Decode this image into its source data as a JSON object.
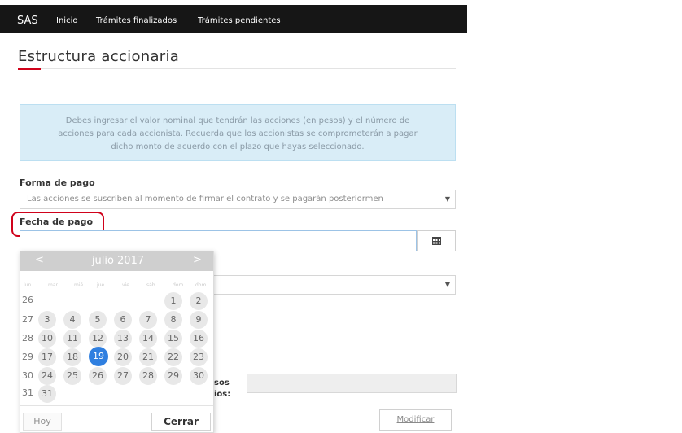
{
  "navbar": {
    "brand": "SAS",
    "items": [
      "Inicio",
      "Trámites finalizados",
      "Trámites pendientes"
    ]
  },
  "page": {
    "title": "Estructura accionaria"
  },
  "alert": {
    "lines": [
      "Debes ingresar el valor nominal que tendrán las acciones (en pesos) y el número de",
      "acciones para cada accionista. Recuerda que los accionistas se comprometerán a pagar",
      "dicho monto de acuerdo con el plazo que hayas seleccionado."
    ]
  },
  "forma_pago": {
    "label": "Forma de pago",
    "selected": "Las acciones se suscriben al momento de firmar el contrato y se pagarán posteriormen"
  },
  "fecha_pago": {
    "label": "Fecha de pago",
    "value": ""
  },
  "second_select": {
    "selected": ""
  },
  "calendar": {
    "month_label": "julio 2017",
    "prev": "<",
    "next": ">",
    "weekday_headers": [
      "lun",
      "mar",
      "mié",
      "jue",
      "vie",
      "sáb",
      "dom"
    ],
    "week_numbers": [
      "26",
      "27",
      "28",
      "29",
      "30",
      "31"
    ],
    "rows": [
      [
        "",
        "",
        "",
        "",
        "",
        "1",
        "2"
      ],
      [
        "3",
        "4",
        "5",
        "6",
        "7",
        "8",
        "9"
      ],
      [
        "10",
        "11",
        "12",
        "13",
        "14",
        "15",
        "16"
      ],
      [
        "17",
        "18",
        "19",
        "20",
        "21",
        "22",
        "23"
      ],
      [
        "24",
        "25",
        "26",
        "27",
        "28",
        "29",
        "30"
      ],
      [
        "31",
        "",
        "",
        "",
        "",
        "",
        ""
      ]
    ],
    "selected_day": "19",
    "today_label": "Hoy",
    "close_label": "Cerrar"
  },
  "partial_labels": {
    "line1": "sos",
    "line2": "ios:"
  },
  "buttons": {
    "modify": "Modificar"
  },
  "colors": {
    "accent_red": "#d0021b",
    "navbar_bg": "#161616",
    "alert_bg": "#d9edf7",
    "selected_day": "#2f7fe0"
  },
  "icons": {
    "calendar": "calendar-icon",
    "select_caret": "caret-down-icon"
  }
}
